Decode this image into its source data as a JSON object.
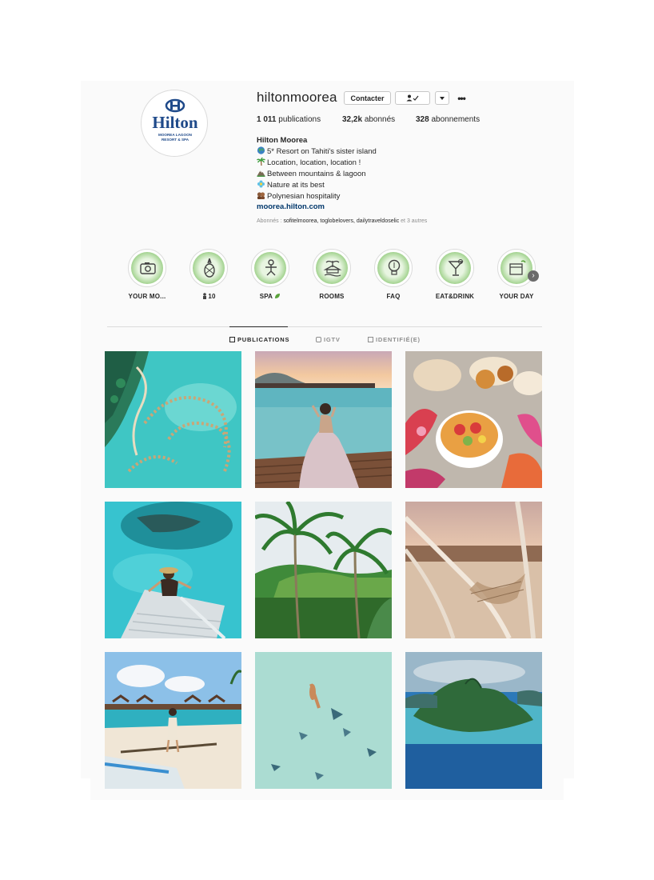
{
  "profile": {
    "username": "hiltonmoorea",
    "contact_label": "Contacter",
    "follow_icon": "person-check-icon",
    "dropdown_icon": "caret-down-icon",
    "more_icon": "ellipsis-icon",
    "more_glyph": "•••",
    "avatar_text": {
      "brand": "Hilton",
      "sub1": "MOOREA LAGOON",
      "sub2": "RESORT & SPA"
    },
    "stats": {
      "publications_count": "1 011",
      "publications_label": "publications",
      "followers_count": "32,2k",
      "followers_label": "abonnés",
      "following_count": "328",
      "following_label": "abonnements"
    },
    "bio": {
      "name": "Hilton Moorea",
      "lines": [
        {
          "emoji": "globe-icon",
          "text": "5* Resort on Tahiti's sister island"
        },
        {
          "emoji": "palm-tree-icon",
          "text": "Location, location, location !"
        },
        {
          "emoji": "mountain-icon",
          "text": "Between mountains & lagoon"
        },
        {
          "emoji": "flower-icon",
          "text": "Nature at its best"
        },
        {
          "emoji": "people-icon",
          "text": "Polynesian hospitality"
        }
      ],
      "link": "moorea.hilton.com"
    },
    "followed_by": {
      "prefix": "Abonnés : ",
      "names": "sofitelmoorea, toglobelovers, dailytraveldoselic",
      "suffix": " et 3 autres"
    }
  },
  "highlights": [
    {
      "label": "YOUR MO...",
      "icon": "camera-icon"
    },
    {
      "label": "10",
      "icon": "pineapple-icon",
      "prefix_icon": "person-icon"
    },
    {
      "label": "SPA",
      "icon": "spa-icon",
      "suffix_icon": "leaf-icon"
    },
    {
      "label": "ROOMS",
      "icon": "bungalow-icon"
    },
    {
      "label": "FAQ",
      "icon": "lightbulb-icon"
    },
    {
      "label": "EAT&DRINK",
      "icon": "cocktail-icon"
    },
    {
      "label": "YOUR DAY",
      "icon": "calendar-icon"
    }
  ],
  "highlights_next_icon": "chevron-right-icon",
  "tabs": [
    {
      "label": "PUBLICATIONS",
      "icon": "grid-icon",
      "active": true
    },
    {
      "label": "IGTV",
      "icon": "tv-icon",
      "active": false
    },
    {
      "label": "IDENTIFIÉ(E)",
      "icon": "tag-icon",
      "active": false
    }
  ],
  "posts": [
    {
      "subject": "aerial overwater bungalows lagoon"
    },
    {
      "subject": "woman on deck at sunset"
    },
    {
      "subject": "tropical breakfast with flowers"
    },
    {
      "subject": "woman on ladder in turquoise water"
    },
    {
      "subject": "palm trees and mountains"
    },
    {
      "subject": "hammock at sunset"
    },
    {
      "subject": "woman on beach with bungalows"
    },
    {
      "subject": "swimmer with rays aerial"
    },
    {
      "subject": "aerial view of Moorea island"
    }
  ],
  "colors": {
    "link": "#00376b",
    "hilton_blue": "#1f4a8a",
    "highlight_green": "#4e9e3f"
  }
}
